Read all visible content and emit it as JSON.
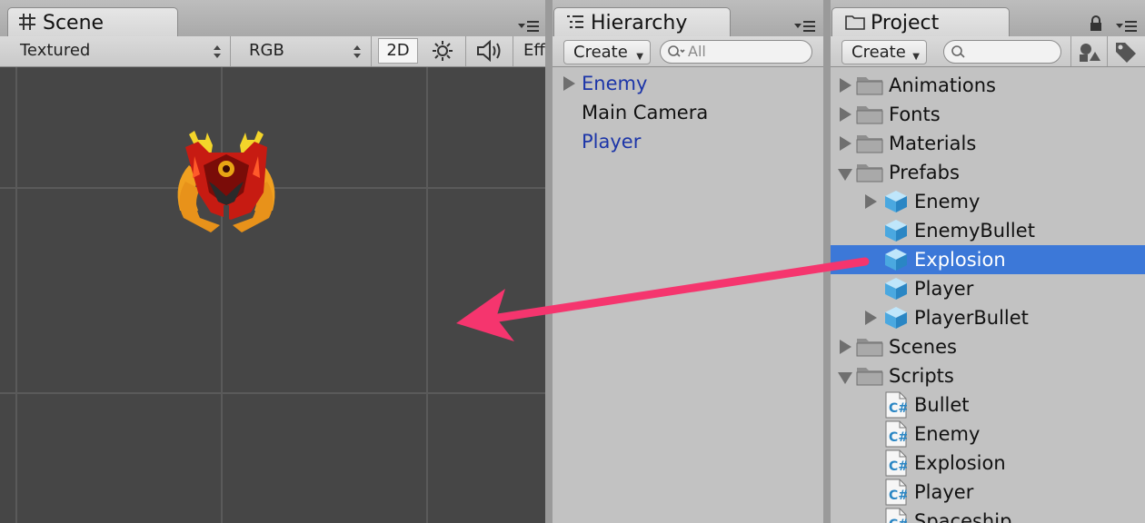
{
  "scene": {
    "tab_label": "Scene",
    "shading_mode": "Textured",
    "render_mode": "RGB",
    "mode_2d": "2D",
    "effects_label": "Eff"
  },
  "hierarchy": {
    "tab_label": "Hierarchy",
    "create_label": "Create",
    "search_placeholder": "All",
    "items": [
      {
        "label": "Enemy",
        "color": "#1c35a8"
      },
      {
        "label": "Main Camera",
        "color": "#111111"
      },
      {
        "label": "Player",
        "color": "#1c35a8"
      }
    ]
  },
  "project": {
    "tab_label": "Project",
    "create_label": "Create",
    "items": [
      {
        "label": "Animations",
        "type": "folder"
      },
      {
        "label": "Fonts",
        "type": "folder"
      },
      {
        "label": "Materials",
        "type": "folder"
      },
      {
        "label": "Prefabs",
        "type": "folder"
      },
      {
        "label": "Enemy",
        "type": "prefab"
      },
      {
        "label": "EnemyBullet",
        "type": "prefab"
      },
      {
        "label": "Explosion",
        "type": "prefab",
        "selected": true
      },
      {
        "label": "Player",
        "type": "prefab"
      },
      {
        "label": "PlayerBullet",
        "type": "prefab"
      },
      {
        "label": "Scenes",
        "type": "folder"
      },
      {
        "label": "Scripts",
        "type": "folder"
      },
      {
        "label": "Bullet",
        "type": "script"
      },
      {
        "label": "Enemy",
        "type": "script"
      },
      {
        "label": "Explosion",
        "type": "script"
      },
      {
        "label": "Player",
        "type": "script"
      },
      {
        "label": "Spaceship",
        "type": "script"
      }
    ]
  },
  "colors": {
    "selection": "#3c78d8",
    "scene_background": "#464646",
    "annotation_arrow": "#f5356e",
    "prefab_link_text": "#1c35a8"
  },
  "icons": {
    "scene_tab": "grid-icon",
    "hierarchy_tab": "list-icon",
    "project_tab": "folder-icon",
    "lock": "lock-icon",
    "panel_menu": "menu-icon",
    "lighting": "sun-icon",
    "audio": "speaker-icon",
    "filter_type": "shapes-icon",
    "filter_label": "tag-icon"
  }
}
